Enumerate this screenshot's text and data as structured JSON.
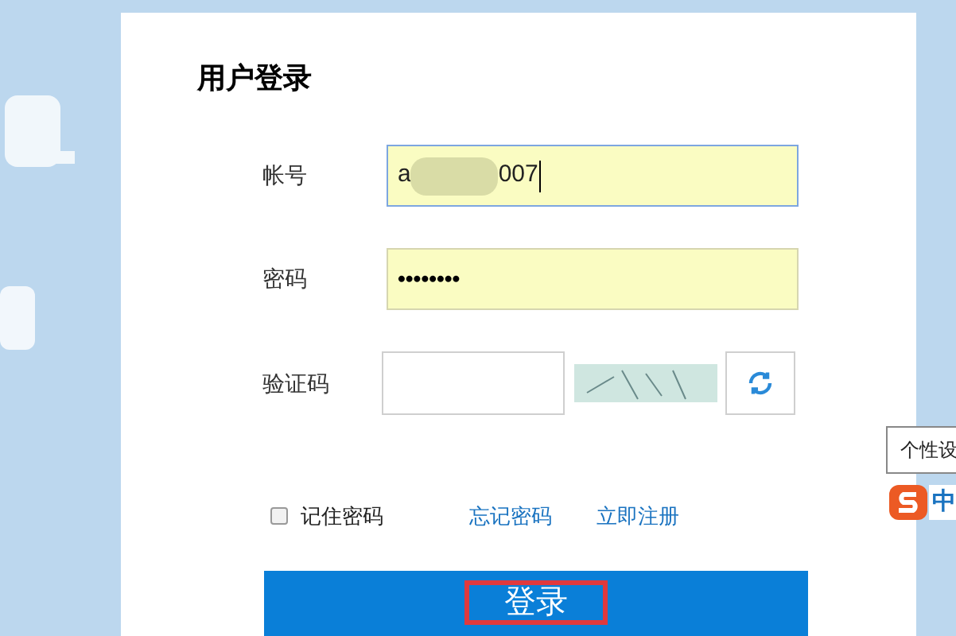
{
  "title": "用户登录",
  "account": {
    "label": "帐号",
    "value_parts": [
      "a",
      "007"
    ],
    "focused": true
  },
  "password": {
    "label": "密码",
    "value": "••••••••"
  },
  "captcha": {
    "label": "验证码"
  },
  "remember": {
    "label": "记住密码",
    "checked": false
  },
  "links": [
    "忘记密码",
    "立即注册"
  ],
  "login_button": {
    "label": "登录",
    "highlighted": true
  },
  "tooltip": "个性设",
  "ime": {
    "mode": "中"
  }
}
